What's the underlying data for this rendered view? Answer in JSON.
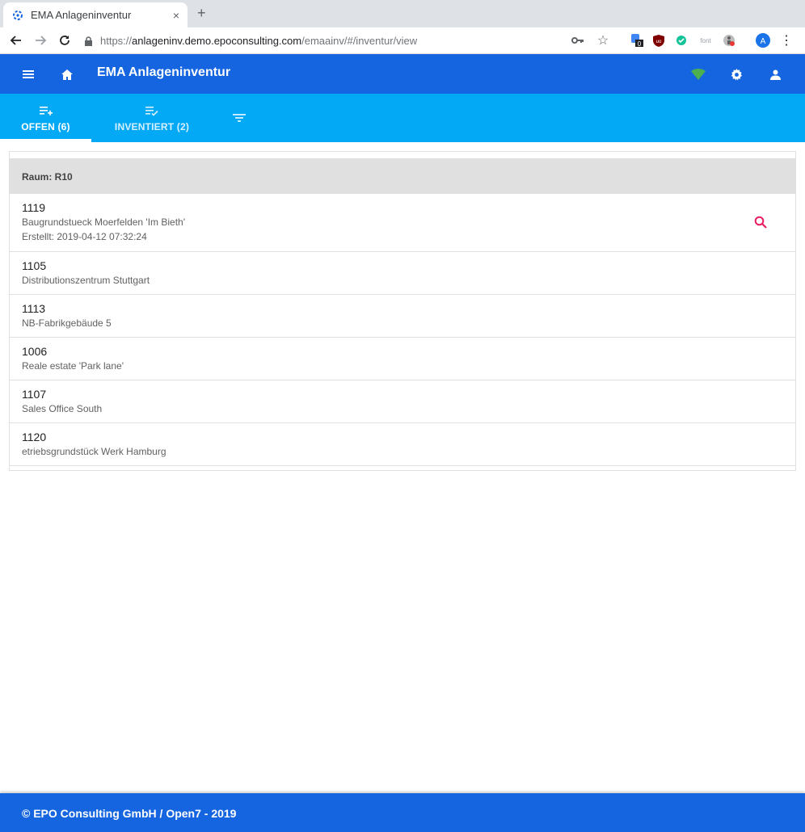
{
  "browser": {
    "tab_title": "EMA Anlageninventur",
    "tab_close": "×",
    "new_tab": "+",
    "url_scheme": "https://",
    "url_host": "anlageninv.demo.epoconsulting.com",
    "url_path": "/emaainv/#/inventur/view",
    "ext_font_label": "font",
    "ext_badge_count": "0",
    "profile_initial": "A"
  },
  "app": {
    "title": "EMA Anlageninventur",
    "colors": {
      "header": "#1565e0",
      "tabs": "#03a9f4",
      "wifi": "#4caf50",
      "search": "#e91e63"
    }
  },
  "tabs": [
    {
      "label": "OFFEN (6)",
      "icon": "playlist-add-icon",
      "active": true
    },
    {
      "label": "INVENTIERT (2)",
      "icon": "playlist-check-icon",
      "active": false
    },
    {
      "label": "",
      "icon": "filter-icon",
      "active": false
    }
  ],
  "list": {
    "group_label": "Raum: R10",
    "items": [
      {
        "number": "1119",
        "description": "Baugrundstueck Moerfelden 'Im Bieth'",
        "extra": "Erstellt: 2019-04-12 07:32:24"
      },
      {
        "number": "1105",
        "description": "Distributionszentrum Stuttgart"
      },
      {
        "number": "1113",
        "description": "NB-Fabrikgebäude 5"
      },
      {
        "number": "1006",
        "description": "Reale estate 'Park lane'"
      },
      {
        "number": "1107",
        "description": "Sales Office South"
      },
      {
        "number": "1120",
        "description": "etriebsgrundstück Werk Hamburg"
      }
    ]
  },
  "footer": {
    "text": "© EPO Consulting GmbH / Open7 - 2019"
  }
}
